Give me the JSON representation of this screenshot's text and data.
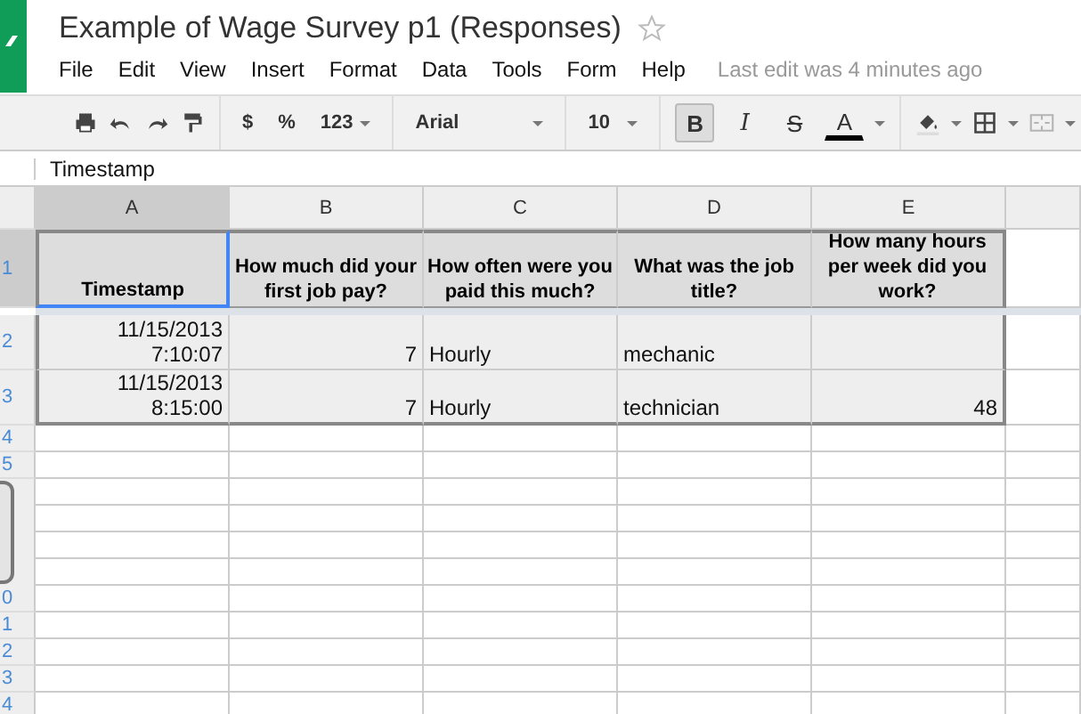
{
  "document": {
    "title": "Example of Wage Survey p1 (Responses)",
    "starred": false,
    "last_edit": "Last edit was 4 minutes ago"
  },
  "menu": [
    "File",
    "Edit",
    "View",
    "Insert",
    "Format",
    "Data",
    "Tools",
    "Form",
    "Help"
  ],
  "toolbar": {
    "number_formats": [
      "$",
      "%",
      "123"
    ],
    "font": "Arial",
    "font_size": "10",
    "format_buttons": [
      {
        "kind": "bold",
        "label": "B",
        "selected": true
      },
      {
        "kind": "italic",
        "label": "I",
        "selected": false
      },
      {
        "kind": "strike",
        "label": "S",
        "selected": false
      },
      {
        "kind": "color",
        "label": "A",
        "selected": false
      }
    ],
    "merge_disabled": true
  },
  "formula_bar": {
    "value": "Timestamp"
  },
  "columns": [
    "A",
    "B",
    "C",
    "D",
    "E"
  ],
  "header_row": {
    "number": "1",
    "cells": [
      "Timestamp",
      "How much did your first job pay?",
      "How often were you paid this much?",
      "What was the job title?",
      "How many hours per week did you work?"
    ]
  },
  "rows": [
    {
      "number": "2",
      "cells": [
        "11/15/2013 7:10:07",
        "7",
        "Hourly",
        "mechanic",
        ""
      ]
    },
    {
      "number": "3",
      "cells": [
        "11/15/2013 8:15:00",
        "7",
        "Hourly",
        "technician",
        "48"
      ]
    }
  ],
  "empty_row_numbers_above": [
    "4",
    "5"
  ],
  "empty_row_numbers_below": [
    "0",
    "1",
    "2",
    "3",
    "4"
  ]
}
